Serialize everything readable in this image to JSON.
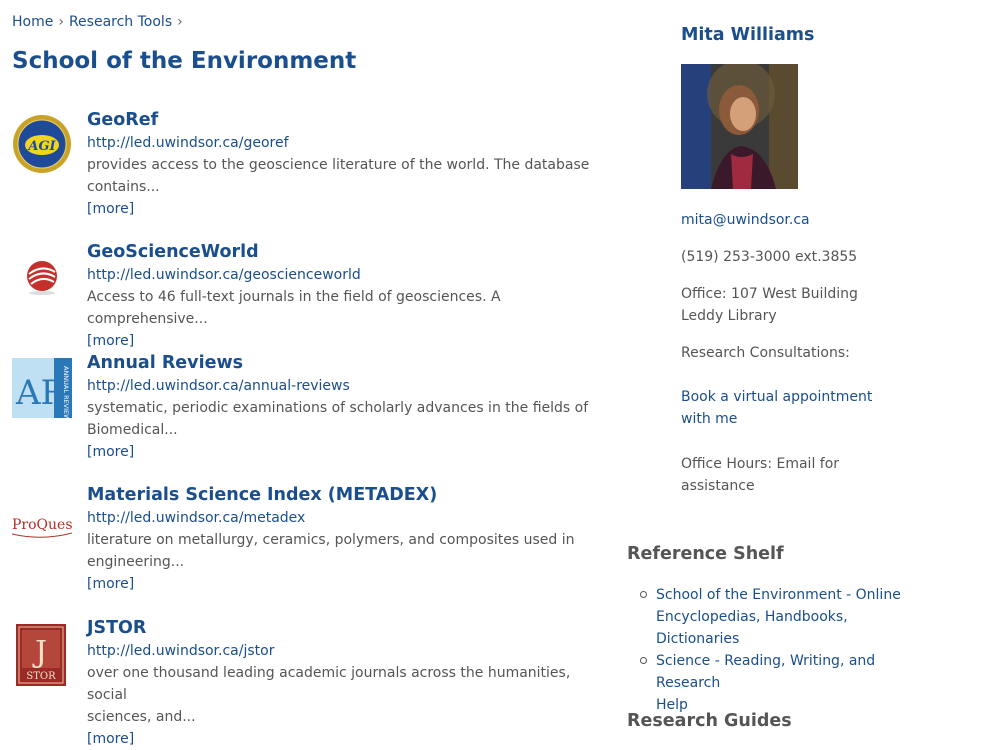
{
  "breadcrumb": {
    "home": "Home",
    "research_tools": "Research Tools",
    "separator": "›"
  },
  "page_title": "School of the Environment",
  "databases": [
    {
      "title": "GeoRef",
      "url": "http://led.uwindsor.ca/georef",
      "desc_line1": "provides access to the geoscience literature of the world. The database",
      "desc_line2": "contains...",
      "more": "[more]",
      "icon": "agi-logo-icon",
      "logo_text": "AGI"
    },
    {
      "title": "GeoScienceWorld",
      "url": "http://led.uwindsor.ca/geoscienceworld",
      "desc_line1": "Access to 46 full-text journals in the field of geosciences. A comprehensive...",
      "desc_line2": "",
      "more": "[more]",
      "icon": "geoscienceworld-logo-icon"
    },
    {
      "title": "Annual Reviews",
      "url": "http://led.uwindsor.ca/annual-reviews",
      "desc_line1": "systematic, periodic examinations of scholarly advances in the fields of",
      "desc_line2": "Biomedical...",
      "more": "[more]",
      "icon": "annual-reviews-logo-icon",
      "logo_text": "AR",
      "logo_subtext": "ANNUAL REVIEWS"
    },
    {
      "title": "Materials Science Index (METADEX)",
      "url": "http://led.uwindsor.ca/metadex",
      "desc_line1": "literature on metallurgy, ceramics, polymers, and composites used in",
      "desc_line2": "engineering...",
      "more": "[more]",
      "icon": "proquest-logo-icon",
      "logo_text": "ProQuest"
    },
    {
      "title": "JSTOR",
      "url": "http://led.uwindsor.ca/jstor",
      "desc_line1": "over one thousand leading academic journals across the humanities, social",
      "desc_line2": "sciences, and...",
      "more": "[more]",
      "icon": "jstor-logo-icon",
      "logo_text": "J",
      "logo_subtext": "STOR"
    }
  ],
  "profile": {
    "name": "Mita Williams",
    "email": "mita@uwindsor.ca",
    "phone": "(519) 253-3000 ext.3855",
    "office_line1": "Office: 107 West Building",
    "office_line2": "Leddy Library",
    "consultations_label": "Research Consultations:",
    "book_line1": "Book a virtual appointment",
    "book_line2": "with me",
    "hours_line1": "Office Hours: Email for",
    "hours_line2": "assistance"
  },
  "reference_shelf": {
    "heading": "Reference Shelf",
    "items": [
      {
        "line1": "School of the Environment - Online",
        "line2": "Encyclopedias, Handbooks,",
        "line3": "Dictionaries"
      },
      {
        "line1": "Science - Reading, Writing, and Research",
        "line2": "Help",
        "line3": ""
      }
    ]
  },
  "research_guides": {
    "heading": "Research Guides"
  },
  "colors": {
    "link": "#1a4e8c",
    "text": "#555555"
  }
}
